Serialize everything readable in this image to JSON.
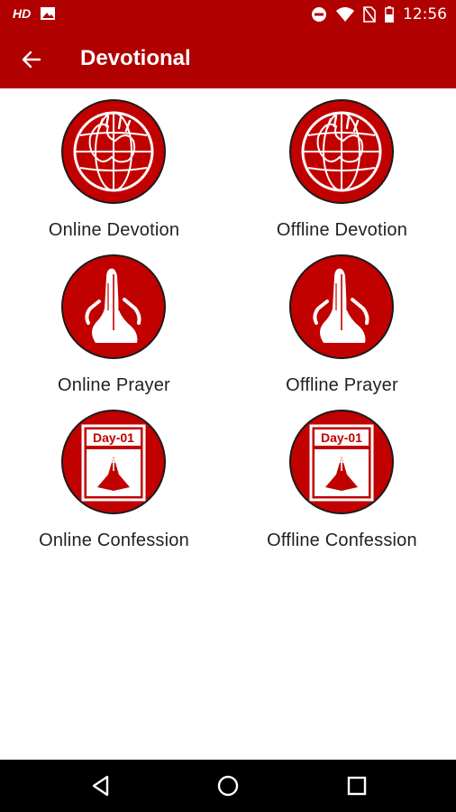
{
  "status_bar": {
    "hd_label": "HD",
    "time": "12:56",
    "icons": [
      "image-icon",
      "dnd-icon",
      "wifi-icon",
      "no-sim-icon",
      "battery-icon"
    ]
  },
  "app_bar": {
    "title": "Devotional",
    "back_icon": "arrow-left-icon",
    "background": "#b00000"
  },
  "tiles": [
    {
      "label": "Online Devotion",
      "icon": "globe-hands-icon"
    },
    {
      "label": "Offline Devotion",
      "icon": "globe-hands-icon"
    },
    {
      "label": "Online Prayer",
      "icon": "praying-hands-icon"
    },
    {
      "label": "Offline Prayer",
      "icon": "praying-hands-icon"
    },
    {
      "label": "Online Confession",
      "icon": "confession-calendar-icon",
      "badge": "Day-01"
    },
    {
      "label": "Offline Confession",
      "icon": "confession-calendar-icon",
      "badge": "Day-01"
    }
  ],
  "nav_bar": {
    "buttons": [
      "back-triangle-icon",
      "home-circle-icon",
      "recents-square-icon"
    ]
  },
  "colors": {
    "accent": "#b00000",
    "icon_fill": "#c10000"
  }
}
